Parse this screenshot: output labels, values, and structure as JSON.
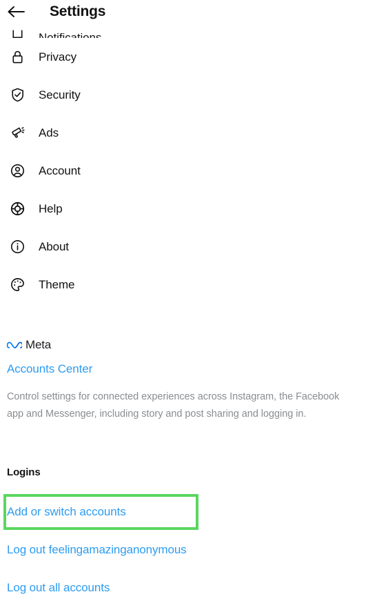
{
  "header": {
    "back_icon": "back-arrow-icon",
    "title": "Settings"
  },
  "settings_list": [
    {
      "icon": "notifications-bell-icon",
      "label": "Notifications",
      "clipped": true
    },
    {
      "icon": "lock-icon",
      "label": "Privacy",
      "clipped": false
    },
    {
      "icon": "shield-check-icon",
      "label": "Security",
      "clipped": false
    },
    {
      "icon": "megaphone-icon",
      "label": "Ads",
      "clipped": false
    },
    {
      "icon": "account-person-icon",
      "label": "Account",
      "clipped": false
    },
    {
      "icon": "lifebuoy-icon",
      "label": "Help",
      "clipped": false
    },
    {
      "icon": "info-circle-icon",
      "label": "About",
      "clipped": false
    },
    {
      "icon": "palette-icon",
      "label": "Theme",
      "clipped": false
    }
  ],
  "meta_section": {
    "logo_icon": "meta-infinity-icon",
    "brand_name": "Meta",
    "accounts_center_label": "Accounts Center",
    "description": "Control settings for connected experiences across Instagram, the Facebook app and Messenger, including story and post sharing and logging in."
  },
  "logins_section": {
    "heading": "Logins",
    "add_or_switch_label": "Add or switch accounts",
    "log_out_user_label": "Log out feelingamazinganonymous",
    "log_out_all_label": "Log out all accounts"
  },
  "colors": {
    "link_blue": "#2d9cf0",
    "highlight_green": "#5cd65f",
    "text_primary": "#121212",
    "text_secondary": "#8a8d91",
    "meta_blue": "#0081fb",
    "background": "#ffffff"
  }
}
